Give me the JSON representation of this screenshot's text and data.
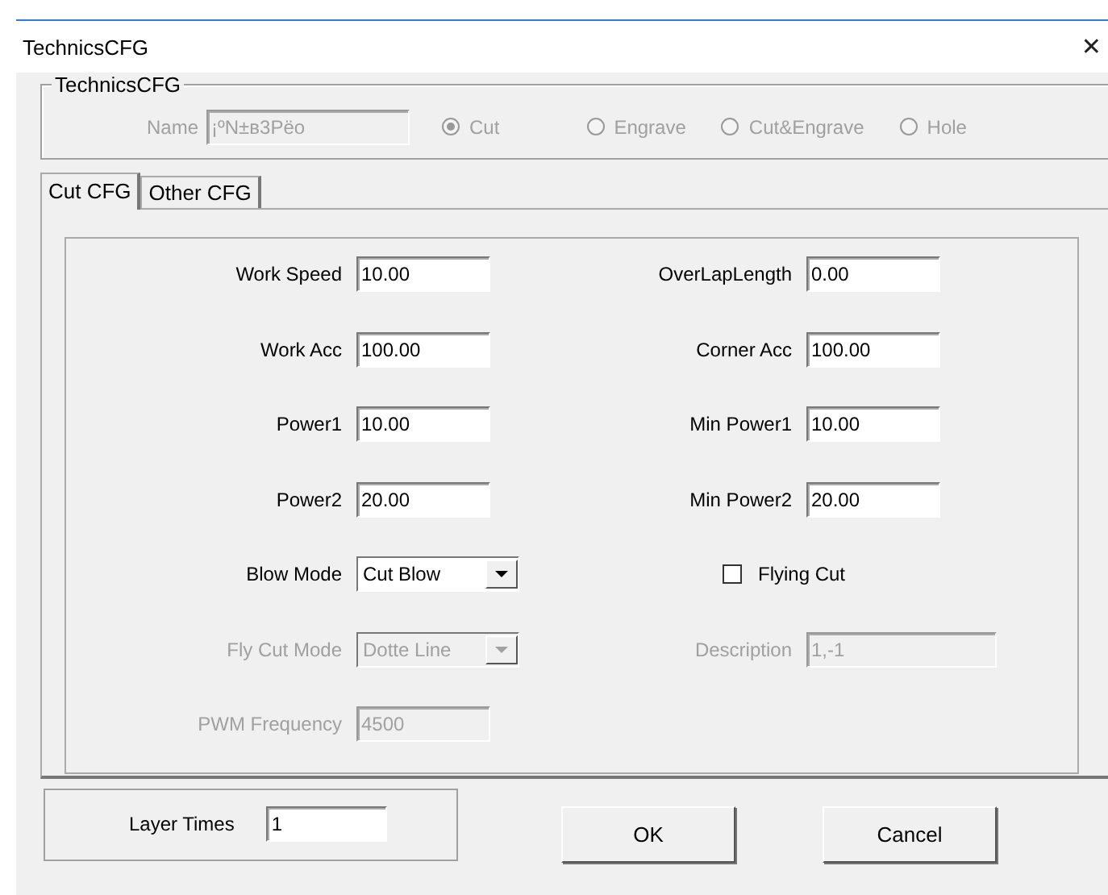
{
  "window": {
    "title": "TechnicsCFG",
    "close": "✕"
  },
  "group": {
    "title": "TechnicsCFG",
    "name_label": "Name",
    "name_value": "¡ºN±в3Pёо",
    "disabled": true,
    "modes": [
      {
        "label": "Cut",
        "selected": true,
        "disabled": true
      },
      {
        "label": "Engrave",
        "selected": false,
        "disabled": true
      },
      {
        "label": "Cut&Engrave",
        "selected": false,
        "disabled": true
      },
      {
        "label": "Hole",
        "selected": false,
        "disabled": true
      }
    ]
  },
  "tabs": [
    {
      "label": "Cut CFG",
      "selected": true
    },
    {
      "label": "Other CFG",
      "selected": false
    }
  ],
  "rows": [
    {
      "cells": [
        {
          "kind": "text",
          "label": "Work Speed",
          "value": "10.00",
          "disabled": false
        },
        {
          "kind": "text",
          "label": "OverLapLength",
          "value": "0.00",
          "disabled": false
        }
      ]
    },
    {
      "cells": [
        {
          "kind": "text",
          "label": "Work Acc",
          "value": "100.00",
          "disabled": false
        },
        {
          "kind": "text",
          "label": "Corner Acc",
          "value": "100.00",
          "disabled": false
        }
      ]
    },
    {
      "cells": [
        {
          "kind": "text",
          "label": "Power1",
          "value": "10.00",
          "disabled": false
        },
        {
          "kind": "text",
          "label": "Min Power1",
          "value": "10.00",
          "disabled": false
        }
      ]
    },
    {
      "cells": [
        {
          "kind": "text",
          "label": "Power2",
          "value": "20.00",
          "disabled": false
        },
        {
          "kind": "text",
          "label": "Min Power2",
          "value": "20.00",
          "disabled": false
        }
      ]
    },
    {
      "cells": [
        {
          "kind": "combo",
          "label": "Blow Mode",
          "value": "Cut Blow",
          "disabled": false
        },
        {
          "kind": "checkbox",
          "label": "Flying Cut",
          "checked": false,
          "disabled": false
        }
      ]
    },
    {
      "cells": [
        {
          "kind": "combo",
          "label": "Fly Cut Mode",
          "value": "Dotte Line",
          "disabled": true
        },
        {
          "kind": "wide",
          "label": "Description",
          "value": "1,-1",
          "disabled": true
        }
      ]
    },
    {
      "cells": [
        {
          "kind": "text",
          "label": "PWM Frequency",
          "value": "4500",
          "disabled": true
        }
      ]
    }
  ],
  "layer_times": {
    "label": "Layer Times",
    "value": "1"
  },
  "buttons": [
    "OK",
    "Cancel"
  ]
}
